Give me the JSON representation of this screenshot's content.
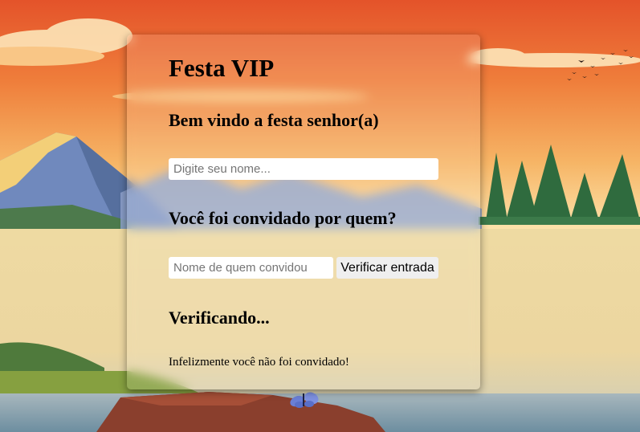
{
  "page": {
    "title": "Festa VIP",
    "welcome_heading": "Bem vindo a festa senhor(a)",
    "name_placeholder": "Digite seu nome...",
    "invited_heading": "Você foi convidado por quem?",
    "inviter_placeholder": "Nome de quem convidou",
    "verify_button": "Verificar entrada",
    "checking_heading": "Verificando...",
    "result_message": "Infelizmente você não foi convidado!"
  },
  "colors": {
    "sky_top": "#e4532a",
    "sky_mid": "#f3a857",
    "sky_low": "#fde3a8",
    "lake": "#efdaa0",
    "mountain": "#6d86b8",
    "tree": "#2f6b3e",
    "butterfly": "#6a7fd6"
  }
}
